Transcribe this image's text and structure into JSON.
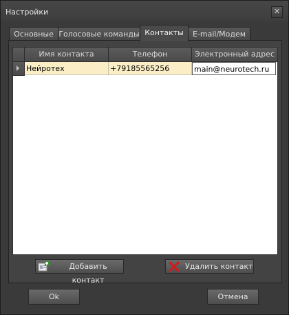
{
  "window": {
    "title": "Настройки",
    "close_glyph": "✕"
  },
  "tabs": [
    {
      "label": "Основные",
      "active": false
    },
    {
      "label": "Голосовые команды",
      "active": false
    },
    {
      "label": "Контакты",
      "active": true
    },
    {
      "label": "E-mail/Модем",
      "active": false
    }
  ],
  "contacts_grid": {
    "columns": [
      "Имя контакта",
      "Телефон",
      "Электронный адрес"
    ],
    "rows": [
      {
        "name": "Нейротех",
        "phone": "+79185565256",
        "email": "main@neurotech.ru"
      }
    ]
  },
  "buttons": {
    "add_contact": "Добавить контакт",
    "delete_contact": "Удалить контакт",
    "ok": "Ok",
    "cancel": "Отмена"
  },
  "colors": {
    "selected_row": "#fbeec6",
    "window_bg": "#3a3a3a",
    "delete_icon": "#d21a1a",
    "add_icon_plus": "#2e9a2e"
  },
  "icons": {
    "add_contact": "contact-card-plus-icon",
    "delete_contact": "red-x-icon",
    "row_pointer": "triangle-right-icon"
  }
}
